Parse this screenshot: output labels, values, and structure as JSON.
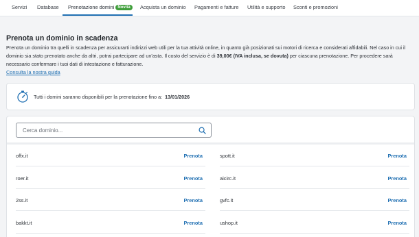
{
  "nav": {
    "tabs": [
      {
        "label": "Servizi"
      },
      {
        "label": "Database"
      },
      {
        "label": "Prenotazione domini",
        "badge": "Novità"
      },
      {
        "label": "Acquista un dominio"
      },
      {
        "label": "Pagamenti e fatture"
      },
      {
        "label": "Utilità e supporto"
      },
      {
        "label": "Sconti e promozioni"
      }
    ],
    "active_tab": "Prenotazione domini"
  },
  "main": {
    "title": "Prenota un dominio in scadenza",
    "desc_part1": "Prenota un dominio tra quelli in scadenza per assicurarti indirizzi web utili per la tua attività online, in quanto già posizionati sui motori di ricerca e considerati affidabili. Nel caso in cui il dominio sia stato prenotato anche da altri, potrai partecipare ad un'asta. Il costo del servizio è di ",
    "desc_price": "39,00€ (IVA inclusa, se dovuta)",
    "desc_part2": " per ciascuna prenotazione. Per procedere sarà necessario confermare i tuoi dati di intestazione e fatturazione.",
    "guide_link": "Consulta la nostra guida"
  },
  "info": {
    "icon": "stopwatch-icon",
    "text": "Tutti i domini saranno disponibili per la prenotazione fino a:",
    "date": "13/01/2026"
  },
  "search": {
    "placeholder": "Cerca dominio...",
    "value": ""
  },
  "domains": {
    "left": [
      {
        "name": "offx.it",
        "action": "Prenota"
      },
      {
        "name": "roer.it",
        "action": "Prenota"
      },
      {
        "name": "2ss.it",
        "action": "Prenota"
      },
      {
        "name": "bakkt.it",
        "action": "Prenota"
      }
    ],
    "right": [
      {
        "name": "spott.it",
        "action": "Prenota"
      },
      {
        "name": "aicirc.it",
        "action": "Prenota"
      },
      {
        "name": "gvfc.it",
        "action": "Prenota"
      },
      {
        "name": "ushop.it",
        "action": "Prenota"
      }
    ]
  },
  "colors": {
    "accent": "#1f6fb2",
    "badge": "#3f9e3a",
    "background": "#f3f4f6"
  }
}
